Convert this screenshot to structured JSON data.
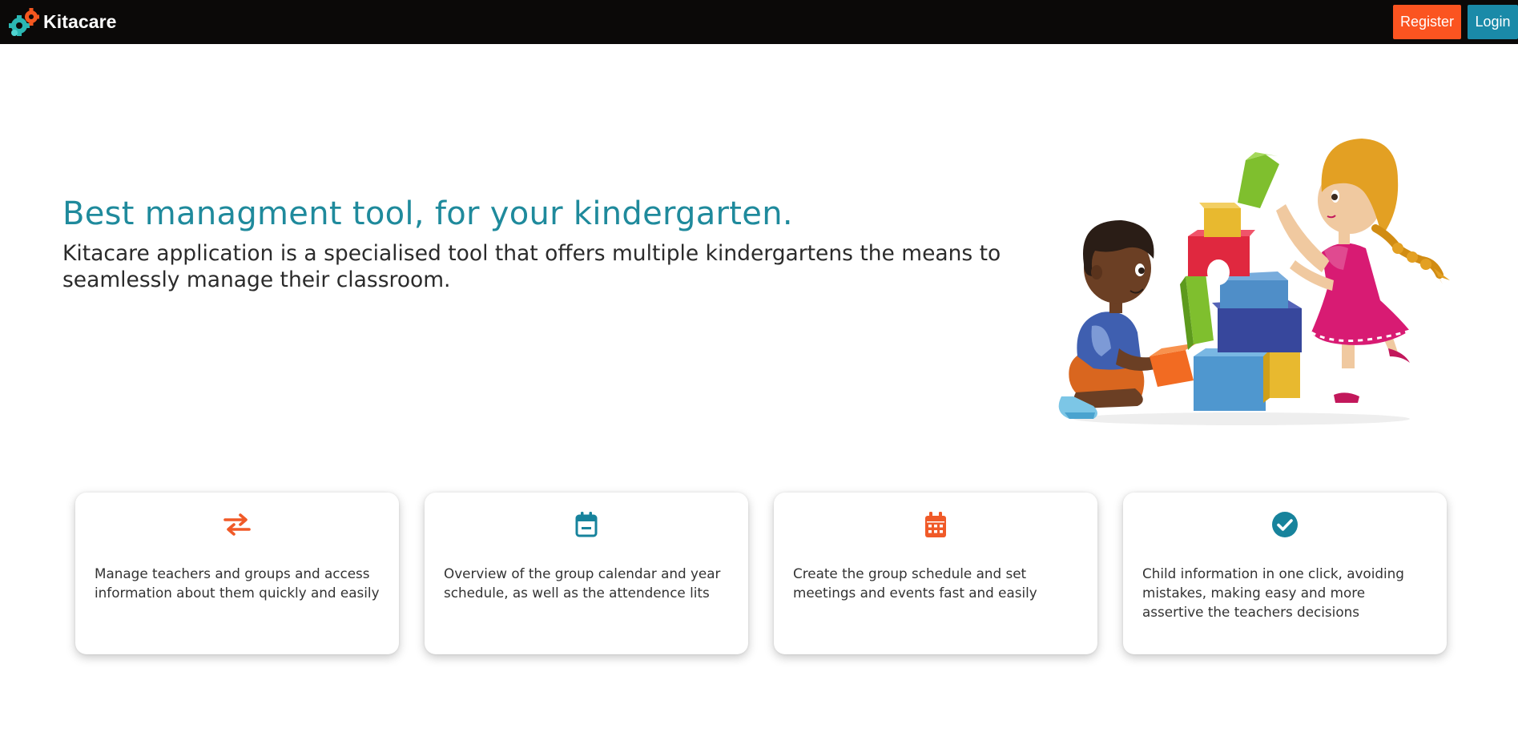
{
  "brand": {
    "name": "Kitacare",
    "logo_icon": "puzzle-gears-logo"
  },
  "nav": {
    "register_label": "Register",
    "login_label": "Login"
  },
  "hero": {
    "title": "Best managment tool, for your kindergarten.",
    "description": "Kitacare application is a specialised tool that offers multiple kindergartens the means to seamlessly manage their classroom."
  },
  "features": [
    {
      "icon": "exchange-arrows-icon",
      "text": "Manage teachers and groups and access information about them quickly and easily"
    },
    {
      "icon": "calendar-minus-icon",
      "text": "Overview of the group calendar and year schedule, as well as the attendence lits"
    },
    {
      "icon": "calendar-grid-icon",
      "text": "Create the group schedule and set meetings and events fast and easily"
    },
    {
      "icon": "check-circle-icon",
      "text": "Child information in one click, avoiding mistakes, making easy and more assertive the teachers decisions"
    }
  ],
  "colors": {
    "navbar_bg": "#0b0908",
    "register_bg": "#fb5420",
    "login_bg": "#1a8aa8",
    "title_teal": "#1f8a9c",
    "icon_orange": "#f05a28",
    "icon_teal": "#17839c"
  }
}
